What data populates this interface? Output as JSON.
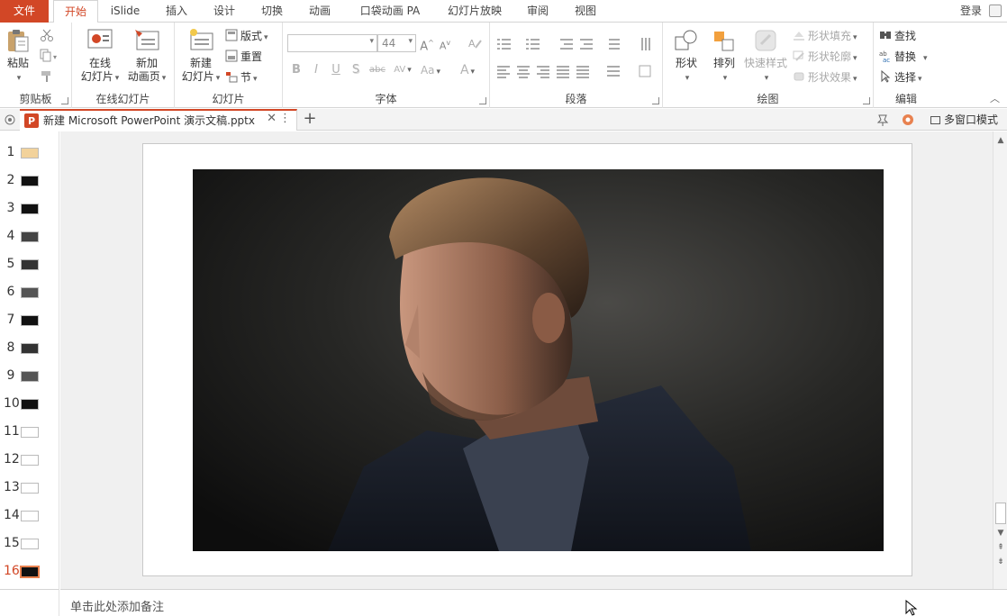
{
  "tabs": {
    "file": "文件",
    "home": "开始",
    "islide": "iSlide",
    "insert": "插入",
    "design": "设计",
    "transitions": "切换",
    "animations": "动画",
    "pocket": "口袋动画 PA",
    "slideshow": "幻灯片放映",
    "review": "审阅",
    "view": "视图"
  },
  "login": "登录",
  "clipboard": {
    "paste": "粘贴",
    "label": "剪贴板"
  },
  "online_slides": {
    "online": "在线",
    "online2": "幻灯片",
    "new_anim": "新加",
    "new_anim2": "动画页",
    "label": "在线幻灯片"
  },
  "slides": {
    "new": "新建",
    "new2": "幻灯片",
    "layout": "版式",
    "reset": "重置",
    "section": "节",
    "label": "幻灯片"
  },
  "font": {
    "name": "",
    "size": "44",
    "label": "字体",
    "bold": "B",
    "italic": "I",
    "underline": "U",
    "shadow": "S",
    "strike": "abc",
    "spacing": "AV",
    "case": "Aa",
    "color": "A",
    "grow": "A",
    "shrink": "A"
  },
  "paragraph": {
    "label": "段落"
  },
  "drawing": {
    "shape": "形状",
    "arrange": "排列",
    "quick_style": "快速样式",
    "fill": "形状填充",
    "outline": "形状轮廓",
    "effect": "形状效果",
    "label": "绘图"
  },
  "editing": {
    "find": "查找",
    "replace": "替换",
    "select": "选择",
    "label": "编辑"
  },
  "document": {
    "title": "新建 Microsoft PowerPoint 演示文稿.pptx",
    "multi_window": "多窗口模式"
  },
  "thumbnails": [
    "1",
    "2",
    "3",
    "4",
    "5",
    "6",
    "7",
    "8",
    "9",
    "10",
    "11",
    "12",
    "13",
    "14",
    "15",
    "16"
  ],
  "selected_slide": 16,
  "notes_placeholder": "单击此处添加备注",
  "colors": {
    "accent": "#d24726",
    "selected_thumb_border": "#e8814f"
  }
}
